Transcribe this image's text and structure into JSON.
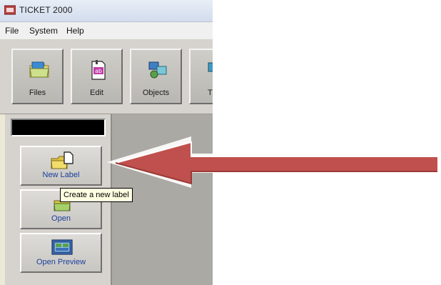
{
  "window": {
    "title": "TICKET 2000"
  },
  "menu": [
    "File",
    "System",
    "Help"
  ],
  "toolbar": {
    "buttons": [
      {
        "label": "Files",
        "icon": "folder-icon"
      },
      {
        "label": "Edit",
        "icon": "edit-document-icon"
      },
      {
        "label": "Objects",
        "icon": "objects-icon"
      },
      {
        "label": "T",
        "icon": "tools-icon"
      }
    ]
  },
  "side_panel": {
    "buttons": [
      {
        "label": "New Label",
        "icon": "new-label-icon"
      },
      {
        "label": "Open",
        "icon": "open-folder-icon"
      },
      {
        "label": "Open Preview",
        "icon": "preview-icon"
      }
    ]
  },
  "tooltip": {
    "text": "Create a new label"
  },
  "annotation": {
    "arrow_color": "#c0504d"
  }
}
